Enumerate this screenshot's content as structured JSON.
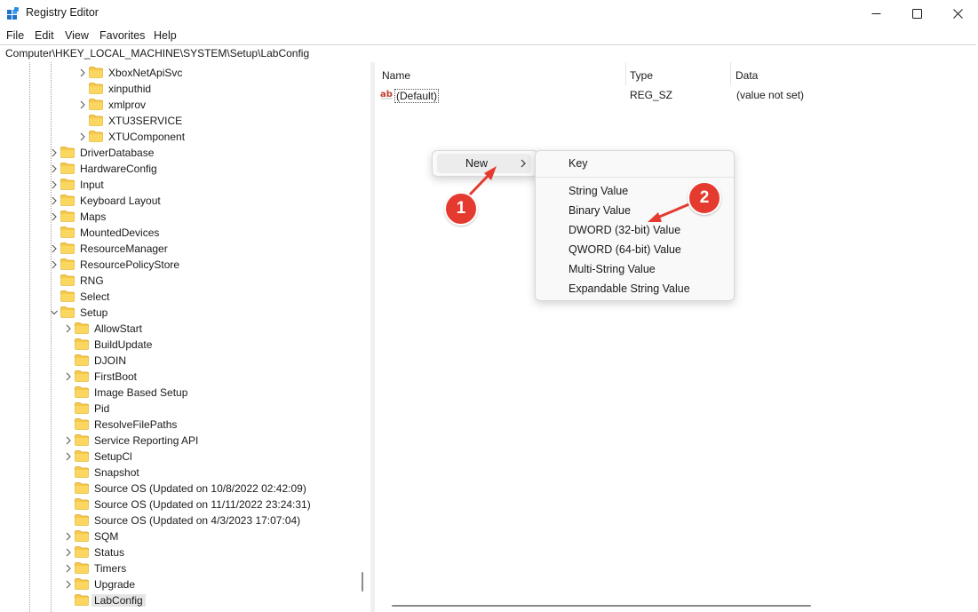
{
  "window": {
    "title": "Registry Editor"
  },
  "menu": {
    "file": "File",
    "edit": "Edit",
    "view": "View",
    "favorites": "Favorites",
    "help": "Help"
  },
  "address": {
    "path": "Computer\\HKEY_LOCAL_MACHINE\\SYSTEM\\Setup\\LabConfig"
  },
  "tree": {
    "items": [
      {
        "label": "XboxNetApiSvc",
        "expandable": true
      },
      {
        "label": "xinputhid",
        "expandable": false
      },
      {
        "label": "xmlprov",
        "expandable": true
      },
      {
        "label": "XTU3SERVICE",
        "expandable": false
      },
      {
        "label": "XTUComponent",
        "expandable": true
      },
      {
        "label": "DriverDatabase",
        "expandable": true
      },
      {
        "label": "HardwareConfig",
        "expandable": true
      },
      {
        "label": "Input",
        "expandable": true
      },
      {
        "label": "Keyboard Layout",
        "expandable": true
      },
      {
        "label": "Maps",
        "expandable": true
      },
      {
        "label": "MountedDevices",
        "expandable": false
      },
      {
        "label": "ResourceManager",
        "expandable": true
      },
      {
        "label": "ResourcePolicyStore",
        "expandable": true
      },
      {
        "label": "RNG",
        "expandable": false
      },
      {
        "label": "Select",
        "expandable": false
      },
      {
        "label": "Setup",
        "expandable": true,
        "expanded": true
      },
      {
        "label": "AllowStart",
        "expandable": true
      },
      {
        "label": "BuildUpdate",
        "expandable": false
      },
      {
        "label": "DJOIN",
        "expandable": false
      },
      {
        "label": "FirstBoot",
        "expandable": true
      },
      {
        "label": "Image Based Setup",
        "expandable": false
      },
      {
        "label": "Pid",
        "expandable": false
      },
      {
        "label": "ResolveFilePaths",
        "expandable": false
      },
      {
        "label": "Service Reporting API",
        "expandable": true
      },
      {
        "label": "SetupCl",
        "expandable": true
      },
      {
        "label": "Snapshot",
        "expandable": false
      },
      {
        "label": "Source OS (Updated on 10/8/2022 02:42:09)",
        "expandable": false
      },
      {
        "label": "Source OS (Updated on 11/11/2022 23:24:31)",
        "expandable": false
      },
      {
        "label": "Source OS (Updated on 4/3/2023 17:07:04)",
        "expandable": false
      },
      {
        "label": "SQM",
        "expandable": true
      },
      {
        "label": "Status",
        "expandable": true
      },
      {
        "label": "Timers",
        "expandable": true
      },
      {
        "label": "Upgrade",
        "expandable": true
      },
      {
        "label": "LabConfig",
        "expandable": false,
        "selected": true
      }
    ]
  },
  "list": {
    "headers": {
      "name": "Name",
      "type": "Type",
      "data": "Data"
    },
    "rows": [
      {
        "name": "(Default)",
        "type": "REG_SZ",
        "data": "(value not set)",
        "icon": "string-value-icon"
      }
    ]
  },
  "context_menu": {
    "new_label": "New",
    "submenu": {
      "key": "Key",
      "string": "String Value",
      "binary": "Binary Value",
      "dword": "DWORD (32-bit) Value",
      "qword": "QWORD (64-bit) Value",
      "multi": "Multi-String Value",
      "expandable": "Expandable String Value"
    }
  },
  "annotations": {
    "step1": "1",
    "step2": "2",
    "color": "#e53a2f"
  },
  "colors": {
    "folder": "#f6c94a",
    "selection": "#e5e5e5",
    "accent": "#0067c0"
  }
}
